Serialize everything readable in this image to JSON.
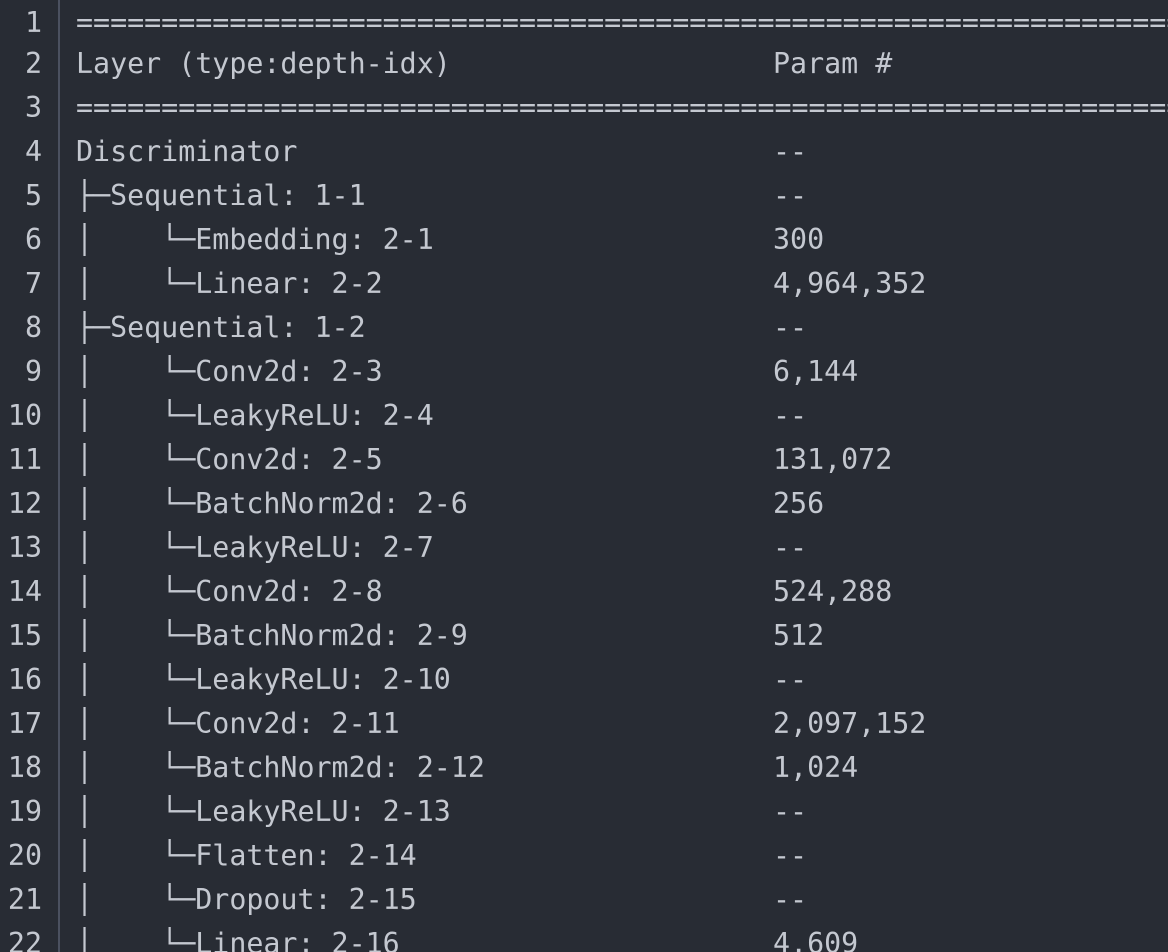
{
  "editor": {
    "lines": [
      {
        "n": "1",
        "text": "==================================================================================",
        "param": ""
      },
      {
        "n": "2",
        "text": "Layer (type:depth-idx)",
        "param": "Param #"
      },
      {
        "n": "3",
        "text": "==================================================================================",
        "param": ""
      },
      {
        "n": "4",
        "text": "Discriminator",
        "param": "--"
      },
      {
        "n": "5",
        "text": "├─Sequential: 1-1",
        "param": "--"
      },
      {
        "n": "6",
        "text": "│    └─Embedding: 2-1",
        "param": "300"
      },
      {
        "n": "7",
        "text": "│    └─Linear: 2-2",
        "param": "4,964,352"
      },
      {
        "n": "8",
        "text": "├─Sequential: 1-2",
        "param": "--"
      },
      {
        "n": "9",
        "text": "│    └─Conv2d: 2-3",
        "param": "6,144"
      },
      {
        "n": "10",
        "text": "│    └─LeakyReLU: 2-4",
        "param": "--"
      },
      {
        "n": "11",
        "text": "│    └─Conv2d: 2-5",
        "param": "131,072"
      },
      {
        "n": "12",
        "text": "│    └─BatchNorm2d: 2-6",
        "param": "256"
      },
      {
        "n": "13",
        "text": "│    └─LeakyReLU: 2-7",
        "param": "--"
      },
      {
        "n": "14",
        "text": "│    └─Conv2d: 2-8",
        "param": "524,288"
      },
      {
        "n": "15",
        "text": "│    └─BatchNorm2d: 2-9",
        "param": "512"
      },
      {
        "n": "16",
        "text": "│    └─LeakyReLU: 2-10",
        "param": "--"
      },
      {
        "n": "17",
        "text": "│    └─Conv2d: 2-11",
        "param": "2,097,152"
      },
      {
        "n": "18",
        "text": "│    └─BatchNorm2d: 2-12",
        "param": "1,024"
      },
      {
        "n": "19",
        "text": "│    └─LeakyReLU: 2-13",
        "param": "--"
      },
      {
        "n": "20",
        "text": "│    └─Flatten: 2-14",
        "param": "--"
      },
      {
        "n": "21",
        "text": "│    └─Dropout: 2-15",
        "param": "--"
      },
      {
        "n": "22",
        "text": "│    └─Linear: 2-16",
        "param": "4,609"
      }
    ]
  },
  "colors": {
    "background": "#282c34",
    "text": "#c4c8d0",
    "gutter_rule": "#4b5160"
  }
}
